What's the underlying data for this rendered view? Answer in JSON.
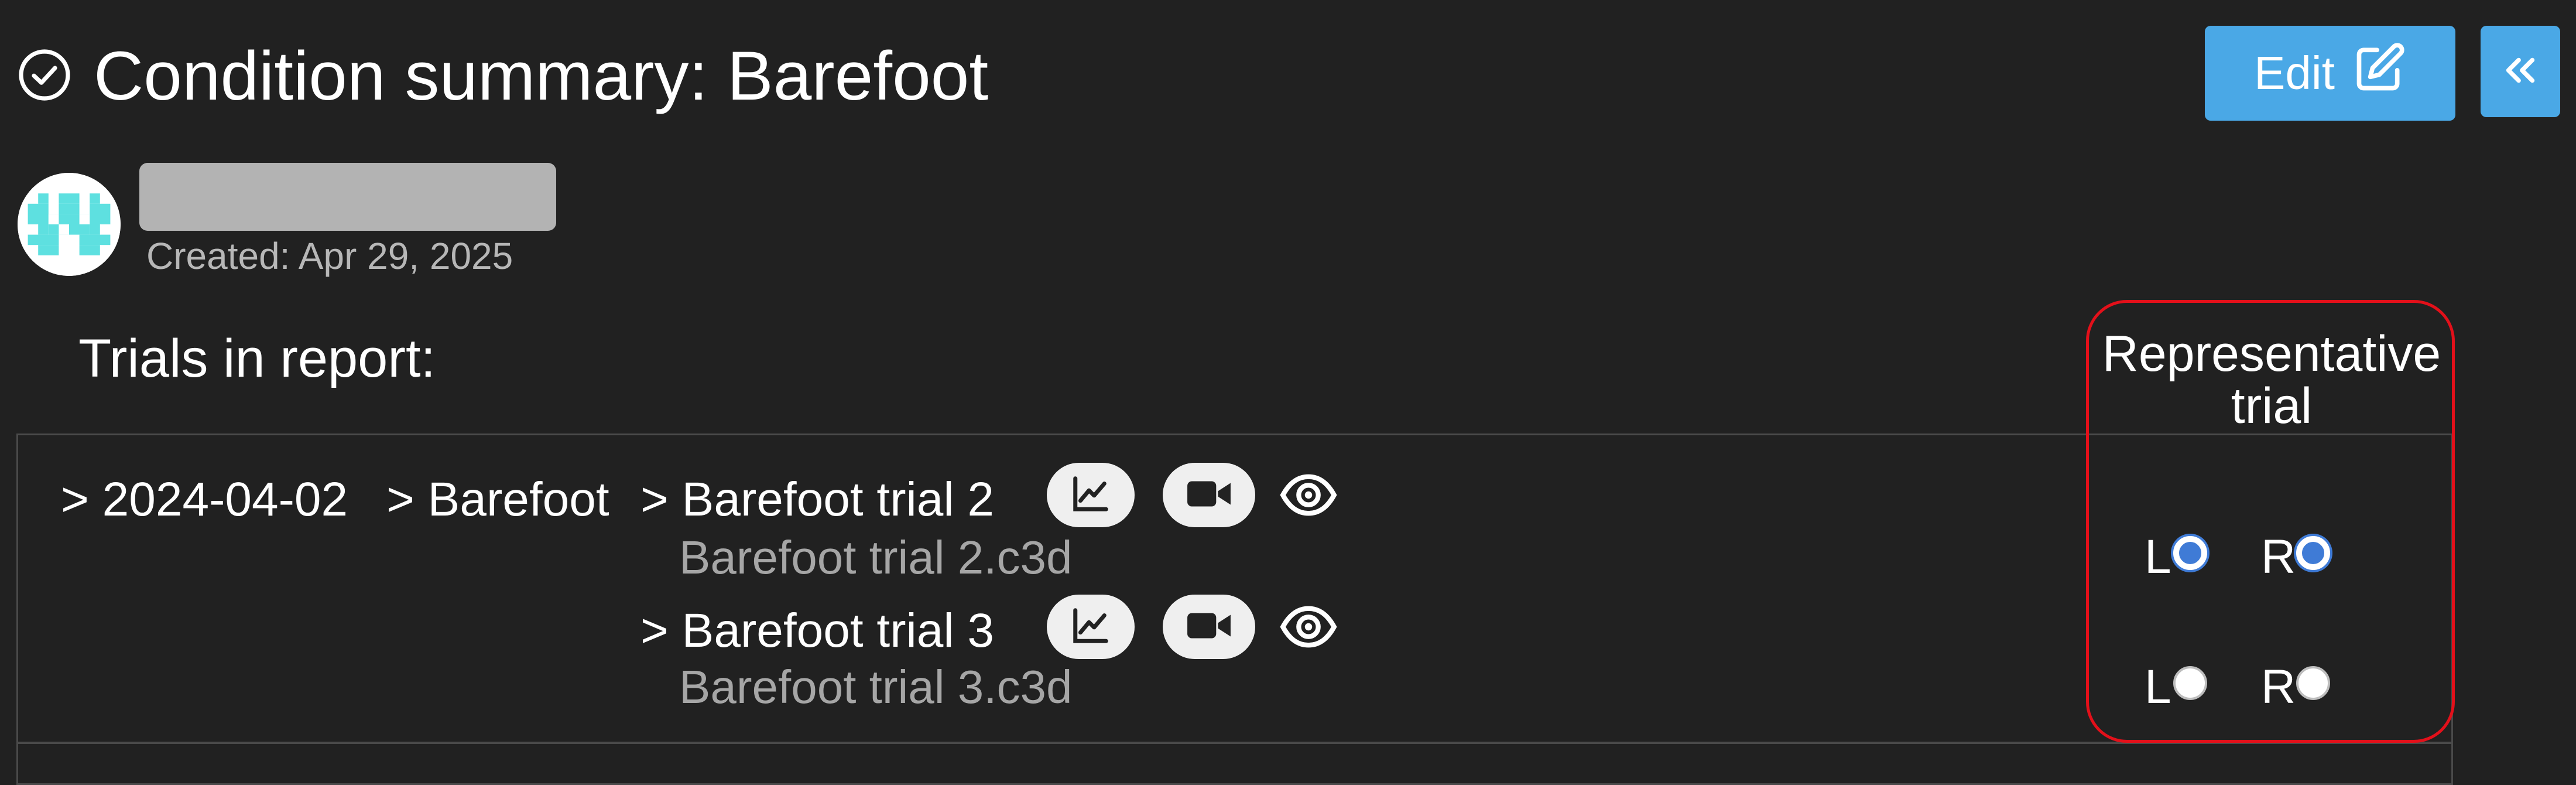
{
  "header": {
    "title": "Condition summary: Barefoot",
    "edit_label": "Edit",
    "collapse_label": "«"
  },
  "user": {
    "created": "Created: Apr 29, 2025"
  },
  "trials": {
    "heading": "Trials in report:",
    "representative_heading": "Representative trial",
    "date_crumb": "> 2024-04-02",
    "condition_crumb": "> Barefoot",
    "rows": [
      {
        "name": "> Barefoot trial 2",
        "file": "Barefoot trial 2.c3d",
        "left_label": "L",
        "right_label": "R",
        "left_selected": true,
        "right_selected": true
      },
      {
        "name": "> Barefoot trial 3",
        "file": "Barefoot trial 3.c3d",
        "left_label": "L",
        "right_label": "R",
        "left_selected": false,
        "right_selected": false
      }
    ]
  },
  "colors": {
    "background": "#212121",
    "accent": "#4aa8e6",
    "radio_selected": "#3f7bd6",
    "highlight_ring": "#e3101a"
  },
  "icons": [
    "check-circle-icon",
    "edit-icon",
    "chevrons-left-icon",
    "chart-icon",
    "video-icon",
    "eye-icon"
  ]
}
